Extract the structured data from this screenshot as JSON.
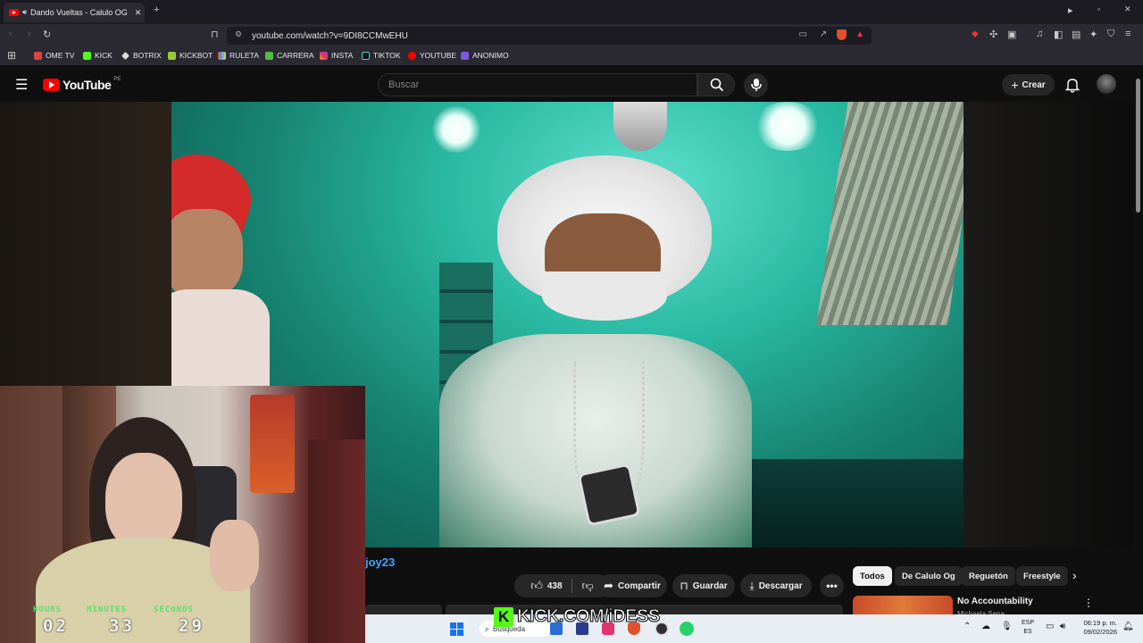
{
  "browser": {
    "tab_title": "Dando Vueltas - Calulo OG",
    "url": "youtube.com/watch?v=9DI8CCMwEHU",
    "bookmarks": [
      "OME TV",
      "KICK",
      "BOTRIX",
      "KICKBOT",
      "RULETA",
      "CARRERA",
      "INSTA",
      "TIKTOK",
      "YOUTUBE",
      "ANONIMO"
    ]
  },
  "youtube": {
    "logo": "YouTube",
    "region": "PE",
    "search_placeholder": "Buscar",
    "create_label": "Crear",
    "channel_partial": "joy23",
    "likes": "438",
    "share_label": "Compartir",
    "save_label": "Guardar",
    "download_label": "Descargar",
    "chips": [
      "Todos",
      "De Calulo Og",
      "Reguetón",
      "Freestyle"
    ],
    "rec_title": "No Accountability",
    "rec_channel": "Michaela Sena"
  },
  "overlay": {
    "timer_labels": [
      "HOURS",
      "MINUTES",
      "SECONDS"
    ],
    "timer_values": [
      "02",
      "33",
      "29"
    ],
    "kick_text": "KICK.COM/iDESS"
  },
  "taskbar": {
    "search_label": "Búsqueda",
    "lang1": "ESP",
    "lang2": "ES",
    "time": "06:19 p. m.",
    "date": "09/02/2026"
  },
  "colors": {
    "yt_red": "#ff0000",
    "kick_green": "#53fc18",
    "timer_green": "#58e06a"
  }
}
